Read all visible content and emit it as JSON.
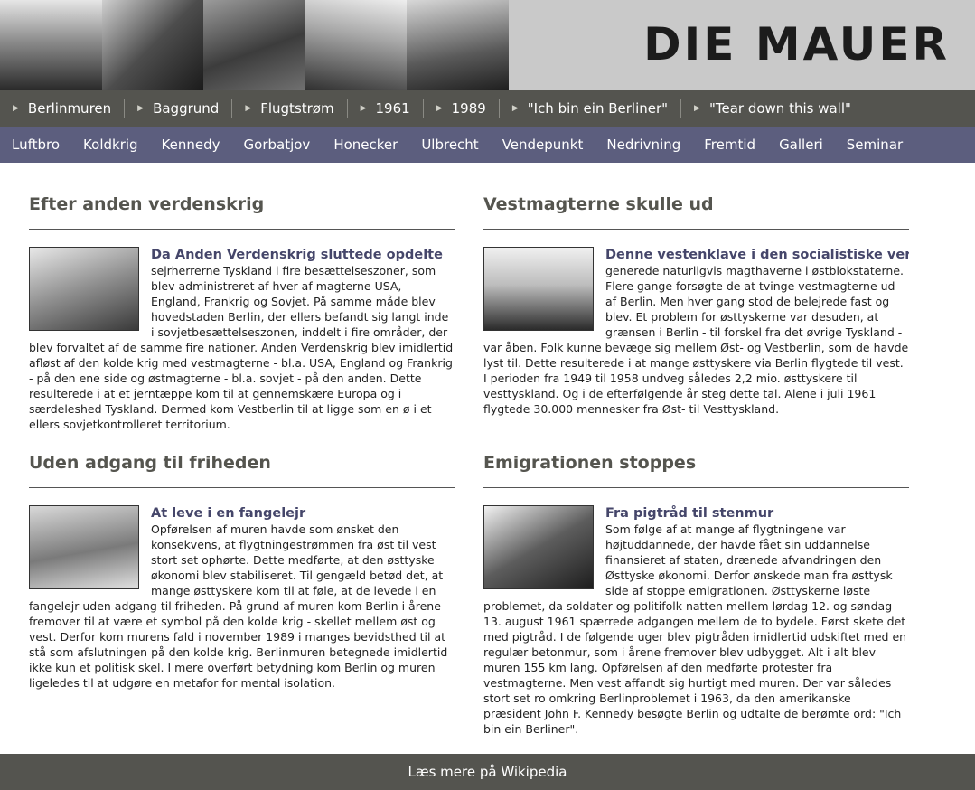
{
  "header": {
    "logo": "DIE MAUER",
    "photos": [
      "checkpoint-photo",
      "soldiers-photo",
      "crowd-photo",
      "tanks-photo",
      "street-photo"
    ]
  },
  "nav_primary": [
    {
      "label": "Berlinmuren"
    },
    {
      "label": "Baggrund"
    },
    {
      "label": "Flugtstrøm"
    },
    {
      "label": "1961"
    },
    {
      "label": "1989"
    },
    {
      "label": "\"Ich bin ein Berliner\""
    },
    {
      "label": "\"Tear down this wall\""
    }
  ],
  "nav_secondary": [
    {
      "label": "Luftbro"
    },
    {
      "label": "Koldkrig"
    },
    {
      "label": "Kennedy"
    },
    {
      "label": "Gorbatjov"
    },
    {
      "label": "Honecker"
    },
    {
      "label": "Ulbrecht"
    },
    {
      "label": "Vendepunkt"
    },
    {
      "label": "Nedrivning"
    },
    {
      "label": "Fremtid"
    },
    {
      "label": "Galleri"
    },
    {
      "label": "Seminar"
    }
  ],
  "sections": [
    {
      "heading": "Efter anden verdenskrig",
      "article_title": "Da Anden Verdenskrig sluttede opdelte",
      "text": "sejrherrerne Tyskland i fire besættelseszoner, som blev administreret af hver af magterne USA, England, Frankrig og Sovjet. På samme måde blev hovedstaden Berlin, der ellers befandt sig langt inde i sovjetbesættelseszonen, inddelt i fire områder, der blev forvaltet af de samme fire nationer. Anden Verdenskrig blev imidlertid afløst af den kolde krig med vestmagterne - bl.a. USA, England og Frankrig - på den ene side og østmagterne - bl.a. sovjet - på den anden. Dette resulterede i at et jerntæppe kom til at gennemskære Europa og i særdeleshed Tyskland. Dermed kom Vestberlin til at ligge som en ø i et ellers sovjetkontrolleret territorium."
    },
    {
      "heading": "Vestmagterne skulle ud",
      "article_title": "Denne vestenklave i den socialistiske verden",
      "text": "generede naturligvis magthaverne i østblokstaterne. Flere gange forsøgte de at tvinge vestmagterne ud af Berlin. Men hver gang stod de belejrede fast og blev. Et problem for østtyskerne var desuden, at grænsen i Berlin - til forskel fra det øvrige Tyskland - var åben. Folk kunne bevæge sig mellem Øst- og Vestberlin, som de havde lyst til. Dette resulterede i at mange østtyskere via Berlin flygtede til vest. I perioden fra 1949 til 1958 undveg således 2,2 mio. østtyskere til vesttyskland. Og i de efterfølgende år steg dette tal. Alene i juli 1961 flygtede 30.000 mennesker fra Øst- til Vesttyskland."
    },
    {
      "heading": "Uden adgang til friheden",
      "article_title": "At leve i en fangelejr",
      "text": "Opførelsen af muren havde som ønsket den konsekvens, at flygtningestrømmen fra øst til vest stort set ophørte. Dette medførte, at den østtyske økonomi blev stabiliseret. Til gengæld betød det, at mange østtyskere kom til at føle, at de levede i en fangelejr uden adgang til friheden. På grund af muren kom Berlin i årene fremover til at være et symbol på den kolde krig - skellet mellem øst og vest. Derfor kom murens fald i november 1989 i manges bevidsthed til at stå som afslutningen på den kolde krig. Berlinmuren betegnede imidlertid ikke kun et politisk skel. I mere overført betydning kom Berlin og muren ligeledes til at udgøre en metafor for mental isolation."
    },
    {
      "heading": "Emigrationen stoppes",
      "article_title": "Fra pigtråd til stenmur",
      "text": "Som følge af at mange af flygtningene var højtuddannede, der havde fået sin uddannelse finansieret af staten, drænede afvandringen den Østtyske økonomi. Derfor ønskede man fra østtysk side af stoppe emigrationen. Østtyskerne løste problemet, da soldater og politifolk natten mellem lørdag 12. og søndag 13. august 1961 spærrede adgangen mellem de to bydele. Først skete det med pigtråd. I de følgende uger blev pigtråden imidlertid udskiftet med en regulær betonmur, som i årene fremover blev udbygget. Alt i alt blev muren 155 km lang. Opførelsen af den medførte protester fra vestmagterne. Men vest affandt sig hurtigt med muren. Der var således stort set ro omkring Berlinproblemet i 1963, da den amerikanske præsident John F. Kennedy besøgte Berlin og udtalte de berømte ord: \"Ich bin ein Berliner\"."
    }
  ],
  "footer": {
    "link_label": "Læs mere på Wikipedia"
  }
}
